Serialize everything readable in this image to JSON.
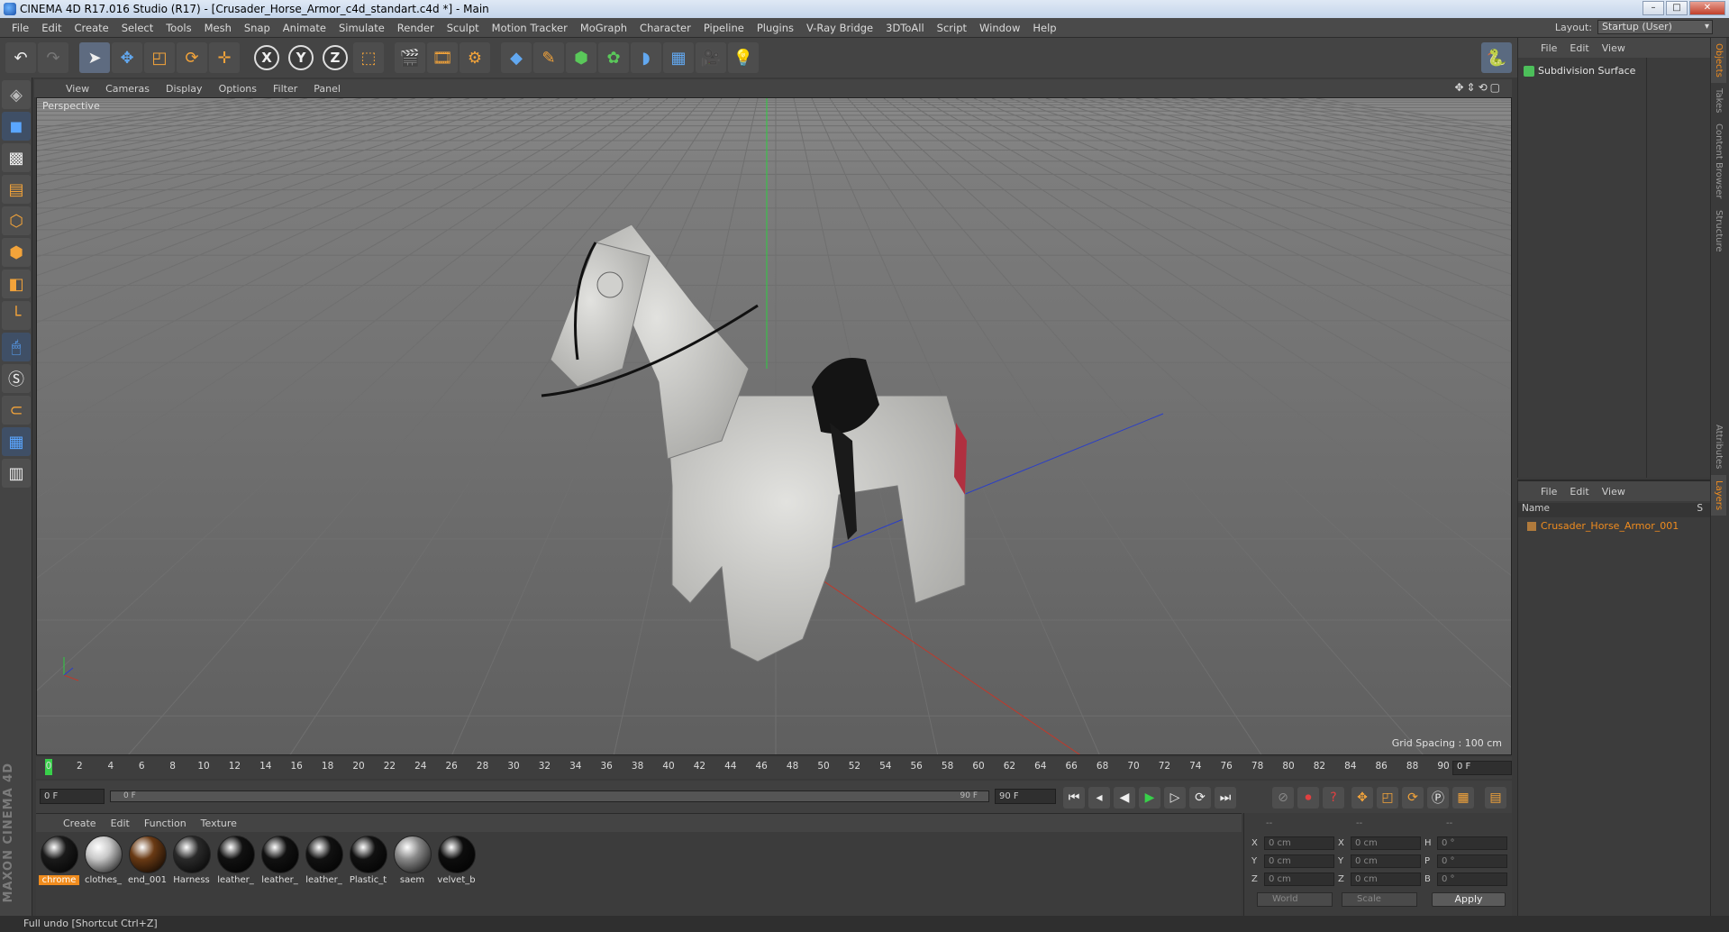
{
  "window": {
    "title": "CINEMA 4D R17.016 Studio (R17) - [Crusader_Horse_Armor_c4d_standart.c4d *] - Main",
    "controls": [
      "–",
      "□",
      "✕"
    ]
  },
  "menubar": {
    "items": [
      "File",
      "Edit",
      "Create",
      "Select",
      "Tools",
      "Mesh",
      "Snap",
      "Animate",
      "Simulate",
      "Render",
      "Sculpt",
      "Motion Tracker",
      "MoGraph",
      "Character",
      "Pipeline",
      "Plugins",
      "V-Ray Bridge",
      "3DToAll",
      "Script",
      "Window",
      "Help"
    ],
    "layout_label": "Layout:",
    "layout_value": "Startup (User)"
  },
  "viewport": {
    "menu": [
      "View",
      "Cameras",
      "Display",
      "Options",
      "Filter",
      "Panel"
    ],
    "camera_label": "Perspective",
    "grid_spacing": "Grid Spacing : 100 cm",
    "colors": {
      "x_axis": "#c0392b",
      "y_axis": "#2ecc40",
      "z_axis": "#2a3ec8"
    }
  },
  "timeline": {
    "ticks": [
      "0",
      "2",
      "4",
      "6",
      "8",
      "10",
      "12",
      "14",
      "16",
      "18",
      "20",
      "22",
      "24",
      "26",
      "28",
      "30",
      "32",
      "34",
      "36",
      "38",
      "40",
      "42",
      "44",
      "46",
      "48",
      "50",
      "52",
      "54",
      "56",
      "58",
      "60",
      "62",
      "64",
      "66",
      "68",
      "70",
      "72",
      "74",
      "76",
      "78",
      "80",
      "82",
      "84",
      "86",
      "88",
      "90"
    ],
    "current_frame": "0 F"
  },
  "transport": {
    "start_field": "0 F",
    "range_start": "0 F",
    "range_end": "90 F",
    "end_field": "90 F",
    "buttons": [
      "⏮",
      "◂",
      "◀",
      "▶",
      "▷",
      "⟳",
      "⏭"
    ]
  },
  "materials": {
    "menu": [
      "Create",
      "Edit",
      "Function",
      "Texture"
    ],
    "items": [
      {
        "name": "chrome",
        "color": "#1a1a1a",
        "selected": true
      },
      {
        "name": "clothes_",
        "color": "#c8c8c8"
      },
      {
        "name": "end_001",
        "color": "#6a3a14"
      },
      {
        "name": "Harness",
        "color": "#2a2a2a"
      },
      {
        "name": "leather_",
        "color": "#111111"
      },
      {
        "name": "leather_",
        "color": "#111111"
      },
      {
        "name": "leather_",
        "color": "#111111"
      },
      {
        "name": "Plastic_t",
        "color": "#111111"
      },
      {
        "name": "saem",
        "color": "#8a8a8a"
      },
      {
        "name": "velvet_b",
        "color": "#0d0d0d"
      }
    ]
  },
  "coordinates": {
    "header": [
      "--",
      "--",
      "--"
    ],
    "rows": [
      {
        "a": "X",
        "av": "0 cm",
        "b": "X",
        "bv": "0 cm",
        "c": "H",
        "cv": "0 °"
      },
      {
        "a": "Y",
        "av": "0 cm",
        "b": "Y",
        "bv": "0 cm",
        "c": "P",
        "cv": "0 °"
      },
      {
        "a": "Z",
        "av": "0 cm",
        "b": "Z",
        "bv": "0 cm",
        "c": "B",
        "cv": "0 °"
      }
    ],
    "mode1": "World",
    "mode2": "Scale",
    "apply": "Apply"
  },
  "objects": {
    "menu": [
      "File",
      "Edit",
      "View"
    ],
    "items": [
      {
        "name": "Subdivision Surface"
      }
    ]
  },
  "layers": {
    "menu": [
      "File",
      "Edit",
      "View"
    ],
    "col_name": "Name",
    "col_s": "S",
    "items": [
      {
        "name": "Crusader_Horse_Armor_001"
      }
    ]
  },
  "side_tabs": [
    "Objects",
    "Takes",
    "Content Browser",
    "Structure",
    "Attributes",
    "Layers"
  ],
  "brand": "MAXON CINEMA 4D",
  "status": "Full undo [Shortcut Ctrl+Z]"
}
